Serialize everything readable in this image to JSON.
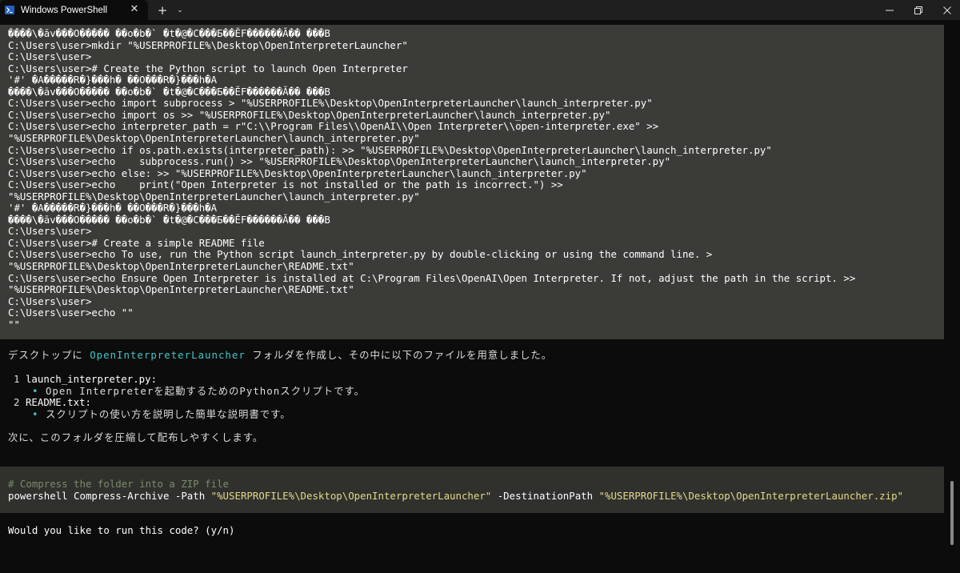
{
  "window": {
    "tab_title": "Windows PowerShell",
    "tab_close": "✕",
    "new_tab": "+",
    "tab_menu": "⌄",
    "minimize": "—",
    "maximize": "❐",
    "close": "✕"
  },
  "terminal": {
    "block1_lines": [
      "����\\�āv���O����� ��o�b�` �t�@�C���Ƃ��ĔF������Ă�� ���B",
      "C:\\Users\\user>mkdir \"%USERPROFILE%\\Desktop\\OpenInterpreterLauncher\"",
      "C:\\Users\\user>",
      "C:\\Users\\user># Create the Python script to launch Open Interpreter",
      "'#' �A�����R�}���h� ��O���R�}���h�A",
      "����\\�āv���O����� ��o�b�` �t�@�C���Ƃ��ĔF������Ă�� ���B",
      "C:\\Users\\user>echo import subprocess > \"%USERPROFILE%\\Desktop\\OpenInterpreterLauncher\\launch_interpreter.py\"",
      "C:\\Users\\user>echo import os >> \"%USERPROFILE%\\Desktop\\OpenInterpreterLauncher\\launch_interpreter.py\"",
      "C:\\Users\\user>echo interpreter_path = r\"C:\\\\Program Files\\\\OpenAI\\\\Open Interpreter\\\\open-interpreter.exe\" >>",
      "\"%USERPROFILE%\\Desktop\\OpenInterpreterLauncher\\launch_interpreter.py\"",
      "C:\\Users\\user>echo if os.path.exists(interpreter_path): >> \"%USERPROFILE%\\Desktop\\OpenInterpreterLauncher\\launch_interpreter.py\"",
      "C:\\Users\\user>echo    subprocess.run() >> \"%USERPROFILE%\\Desktop\\OpenInterpreterLauncher\\launch_interpreter.py\"",
      "C:\\Users\\user>echo else: >> \"%USERPROFILE%\\Desktop\\OpenInterpreterLauncher\\launch_interpreter.py\"",
      "C:\\Users\\user>echo    print(\"Open Interpreter is not installed or the path is incorrect.\") >>",
      "\"%USERPROFILE%\\Desktop\\OpenInterpreterLauncher\\launch_interpreter.py\"",
      "'#' �A�����R�}���h� ��O���R�}���h�A",
      "����\\�āv���O����� ��o�b�` �t�@�C���Ƃ��ĔF������Ă�� ���B",
      "C:\\Users\\user>",
      "C:\\Users\\user># Create a simple README file",
      "C:\\Users\\user>echo To use, run the Python script launch_interpreter.py by double-clicking or using the command line. >",
      "\"%USERPROFILE%\\Desktop\\OpenInterpreterLauncher\\README.txt\"",
      "C:\\Users\\user>echo Ensure Open Interpreter is installed at C:\\Program Files\\OpenAI\\Open Interpreter. If not, adjust the path in the script. >>",
      "\"%USERPROFILE%\\Desktop\\OpenInterpreterLauncher\\README.txt\"",
      "C:\\Users\\user>",
      "C:\\Users\\user>echo \"\"",
      "\"\""
    ],
    "message": {
      "intro_prefix": "デスクトップに ",
      "folder_name": "OpenInterpreterLauncher",
      "intro_suffix": " フォルダを作成し、その中に以下のファイルを用意しました。",
      "item1_num": "1",
      "item1_name": "launch_interpreter.py:",
      "item1_bullet": "•",
      "item1_desc": "Open Interpreterを起動するためのPythonスクリプトです。",
      "item2_num": "2",
      "item2_name": "README.txt:",
      "item2_bullet": "•",
      "item2_desc": "スクリプトの使い方を説明した簡単な説明書です。",
      "next": "次に、このフォルダを圧縮して配布しやすくします。"
    },
    "code": {
      "comment": "# Compress the folder into a ZIP file",
      "cmd": "powershell Compress-Archive -Path ",
      "path_arg": "\"%USERPROFILE%\\Desktop\\OpenInterpreterLauncher\"",
      "dest_flag": " -DestinationPath ",
      "dest_arg": "\"%USERPROFILE%\\Desktop\\OpenInterpreterLauncher.zip\""
    },
    "prompt": "Would you like to run this code? (y/n)"
  }
}
